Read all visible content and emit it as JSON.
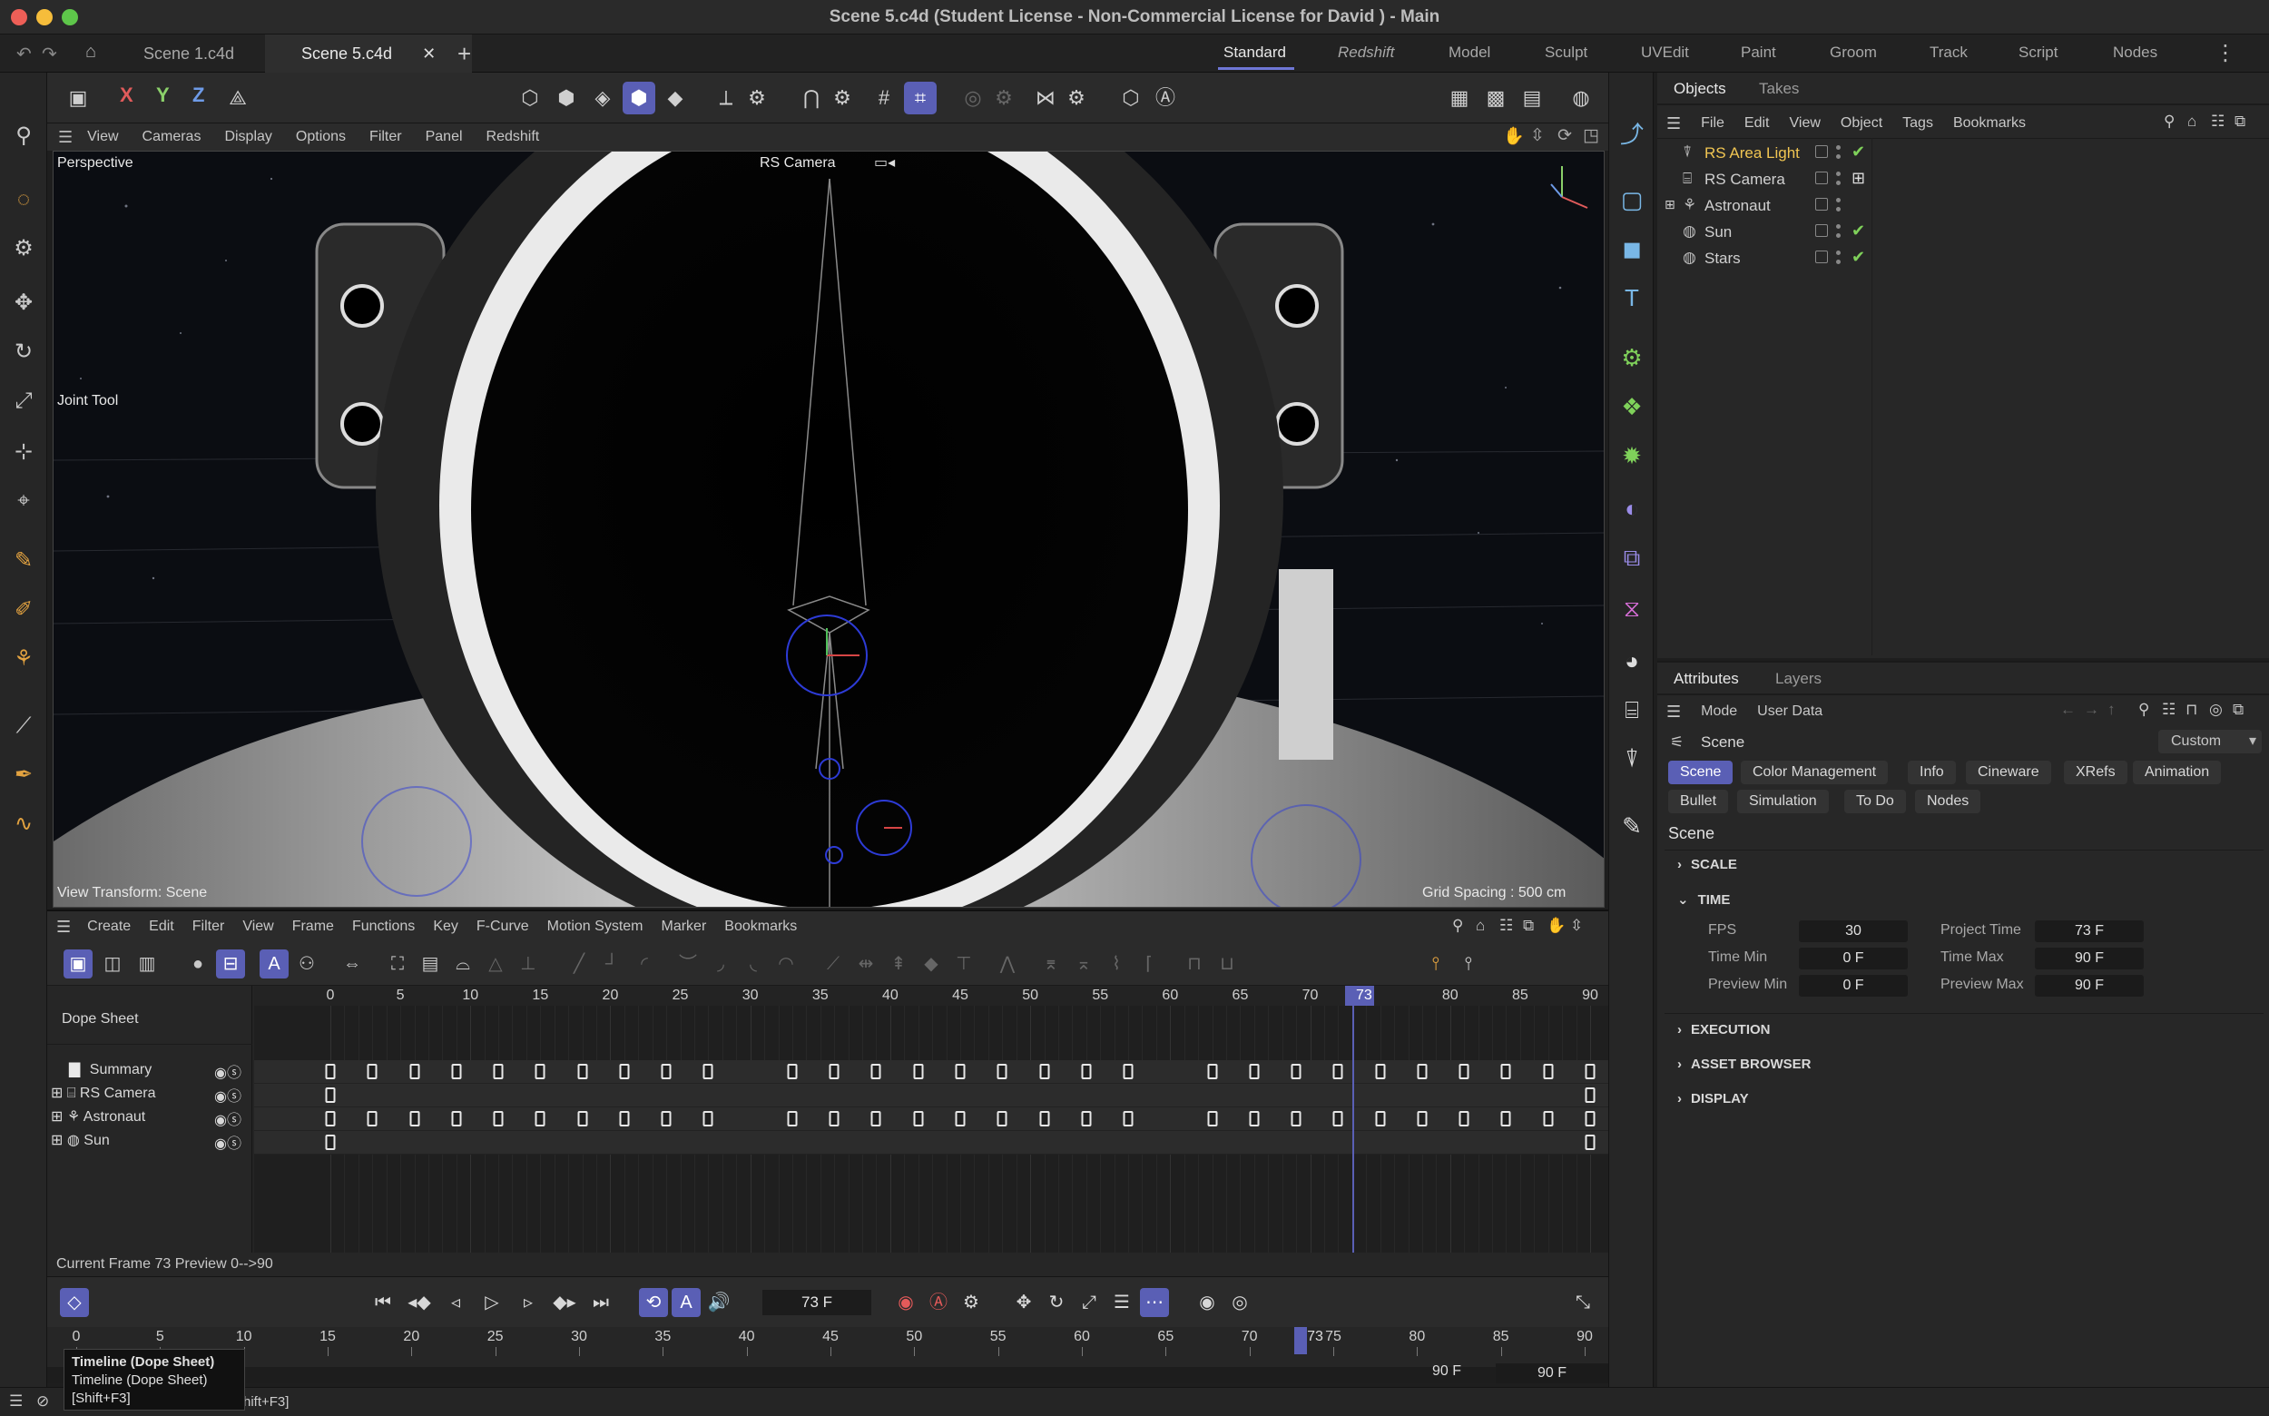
{
  "window": {
    "title": "Scene 5.c4d (Student License - Non-Commercial License for David ) - Main"
  },
  "doc_tabs": [
    {
      "label": "Scene 1.c4d"
    },
    {
      "label": "Scene 5.c4d"
    }
  ],
  "layouts": [
    "Standard",
    "Redshift",
    "Model",
    "Sculpt",
    "UVEdit",
    "Paint",
    "Groom",
    "Track",
    "Script",
    "Nodes"
  ],
  "axes": {
    "x": "X",
    "y": "Y",
    "z": "Z"
  },
  "viewport_menu": [
    "View",
    "Cameras",
    "Display",
    "Options",
    "Filter",
    "Panel",
    "Redshift"
  ],
  "viewport": {
    "view_name": "Perspective",
    "camera_label": "RS Camera",
    "tool_label": "Joint Tool",
    "view_transform": "View Transform: Scene",
    "grid_spacing": "Grid Spacing : 500 cm"
  },
  "objects_panel": {
    "tabs": [
      "Objects",
      "Takes"
    ],
    "menu": [
      "File",
      "Edit",
      "View",
      "Object",
      "Tags",
      "Bookmarks"
    ],
    "items": [
      {
        "name": "RS Area Light",
        "icon": "area-light-icon",
        "color": "#f0c552",
        "checked": true
      },
      {
        "name": "RS Camera",
        "icon": "camera-icon",
        "color": "#d0d0d0",
        "checked": false
      },
      {
        "name": "Astronaut",
        "icon": "joint-icon",
        "color": "#d0d0d0",
        "checked": false
      },
      {
        "name": "Sun",
        "icon": "sphere-icon",
        "color": "#d0d0d0",
        "checked": true
      },
      {
        "name": "Stars",
        "icon": "sphere-icon",
        "color": "#d0d0d0",
        "checked": true
      }
    ]
  },
  "attributes_panel": {
    "tabs": [
      "Attributes",
      "Layers"
    ],
    "menu": [
      "Mode",
      "User Data"
    ],
    "object_label": "Scene",
    "preset": "Custom",
    "chips_row1": [
      "Scene",
      "Color Management",
      "Info",
      "Cineware",
      "XRefs",
      "Animation"
    ],
    "chips_row2": [
      "Bullet",
      "Simulation",
      "To Do",
      "Nodes"
    ],
    "heading": "Scene",
    "sections": {
      "scale": "SCALE",
      "time": "TIME",
      "execution": "EXECUTION",
      "asset_browser": "ASSET BROWSER",
      "display": "DISPLAY"
    },
    "time": {
      "fps_label": "FPS",
      "fps": "30",
      "project_time_label": "Project Time",
      "project_time": "73 F",
      "time_min_label": "Time Min",
      "time_min": "0 F",
      "time_max_label": "Time Max",
      "time_max": "90 F",
      "preview_min_label": "Preview Min",
      "preview_min": "0 F",
      "preview_max_label": "Preview Max",
      "preview_max": "90 F"
    }
  },
  "dopesheet": {
    "menu": [
      "Create",
      "Edit",
      "Filter",
      "View",
      "Frame",
      "Functions",
      "Key",
      "F-Curve",
      "Motion System",
      "Marker",
      "Bookmarks"
    ],
    "title": "Dope Sheet",
    "ticks": [
      0,
      5,
      10,
      15,
      20,
      25,
      30,
      35,
      40,
      45,
      50,
      55,
      60,
      65,
      70,
      75,
      80,
      85,
      90
    ],
    "current_frame": 73,
    "current_frame_label": "73",
    "tracks": [
      {
        "name": "Summary",
        "keys": [
          0,
          3,
          6,
          9,
          12,
          15,
          18,
          21,
          24,
          27,
          33,
          36,
          39,
          42,
          45,
          48,
          51,
          54,
          57,
          63,
          66,
          69,
          72,
          75,
          78,
          81,
          84,
          87,
          90
        ]
      },
      {
        "name": "RS Camera",
        "keys": [
          0,
          90
        ]
      },
      {
        "name": "Astronaut",
        "keys": [
          0,
          3,
          6,
          9,
          12,
          15,
          18,
          21,
          24,
          27,
          33,
          36,
          39,
          42,
          45,
          48,
          51,
          54,
          57,
          63,
          66,
          69,
          72,
          75,
          78,
          81,
          84,
          87,
          90
        ]
      },
      {
        "name": "Sun",
        "keys": [
          0,
          90
        ]
      }
    ],
    "status": "Current Frame  73  Preview  0-->90"
  },
  "transport": {
    "frame_field": "73 F",
    "ruler_ticks": [
      0,
      5,
      10,
      15,
      20,
      25,
      30,
      35,
      40,
      45,
      50,
      55,
      60,
      65,
      70,
      75,
      80,
      85,
      90
    ],
    "current_label": "73",
    "end_a": "90 F",
    "end_b": "90 F"
  },
  "tooltip": {
    "title": "Timeline (Dope Sheet)",
    "line2": "Timeline (Dope Sheet)",
    "shortcut": "[Shift+F3]",
    "behind": "hift+F3]"
  },
  "colors": {
    "accent": "#5a5fb5",
    "keyframe": "#e8e8e8",
    "light_name": "#f0c552",
    "check": "#7fd15a"
  }
}
